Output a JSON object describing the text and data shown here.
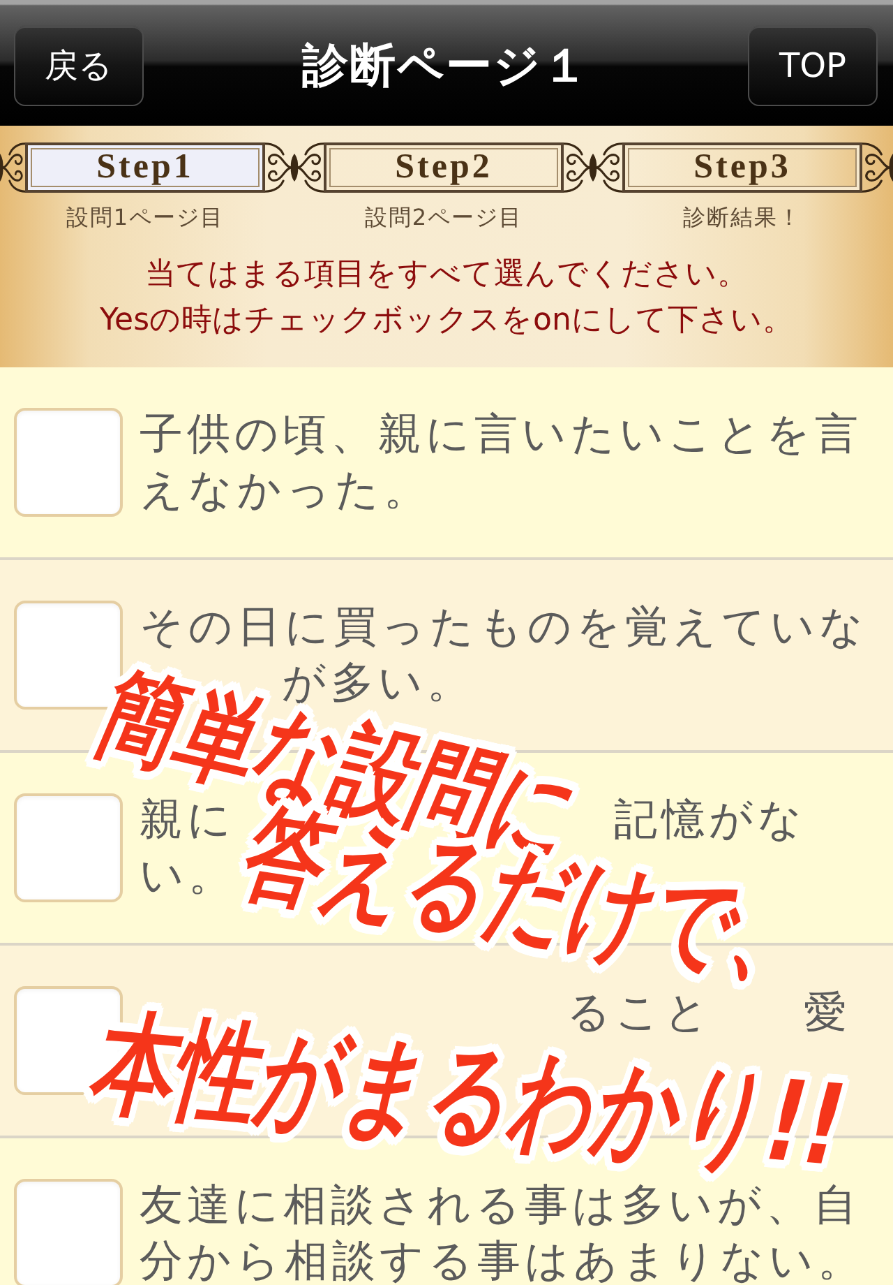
{
  "nav_bar": {
    "back_button": "戻る",
    "title": "診断ページ１",
    "top_button": "TOP"
  },
  "steps": [
    {
      "label": "Step1",
      "caption": "設問1ページ目",
      "selected": true
    },
    {
      "label": "Step2",
      "caption": "設問2ページ目",
      "selected": false
    },
    {
      "label": "Step3",
      "caption": "診断結果！",
      "selected": false
    }
  ],
  "instructions": [
    "当てはまる項目をすべて選んでください。",
    "Yesの時はチェックボックスをonにして下さい。"
  ],
  "questions": [
    {
      "checked": false,
      "lines": [
        [
          "子供の頃、親に言いたいことを言"
        ],
        [
          "えなかった。"
        ]
      ]
    },
    {
      "checked": false,
      "lines": [
        [
          "その日に買ったものを覚えていな"
        ],
        [
          "が多い。"
        ]
      ]
    },
    {
      "checked": false,
      "lines": [
        [
          "親に",
          "記憶がな"
        ],
        [
          "い。"
        ]
      ]
    },
    {
      "checked": false,
      "lines": [
        [
          "ること",
          "愛"
        ]
      ]
    },
    {
      "checked": false,
      "lines": [
        [
          "友達に相談される事は多いが、自"
        ],
        [
          "分から相談する事はあまりない。"
        ]
      ]
    }
  ],
  "promo_caption": {
    "lines": [
      "簡単な設問に",
      "答えるだけで、",
      "本性がまるわかり!!"
    ]
  }
}
